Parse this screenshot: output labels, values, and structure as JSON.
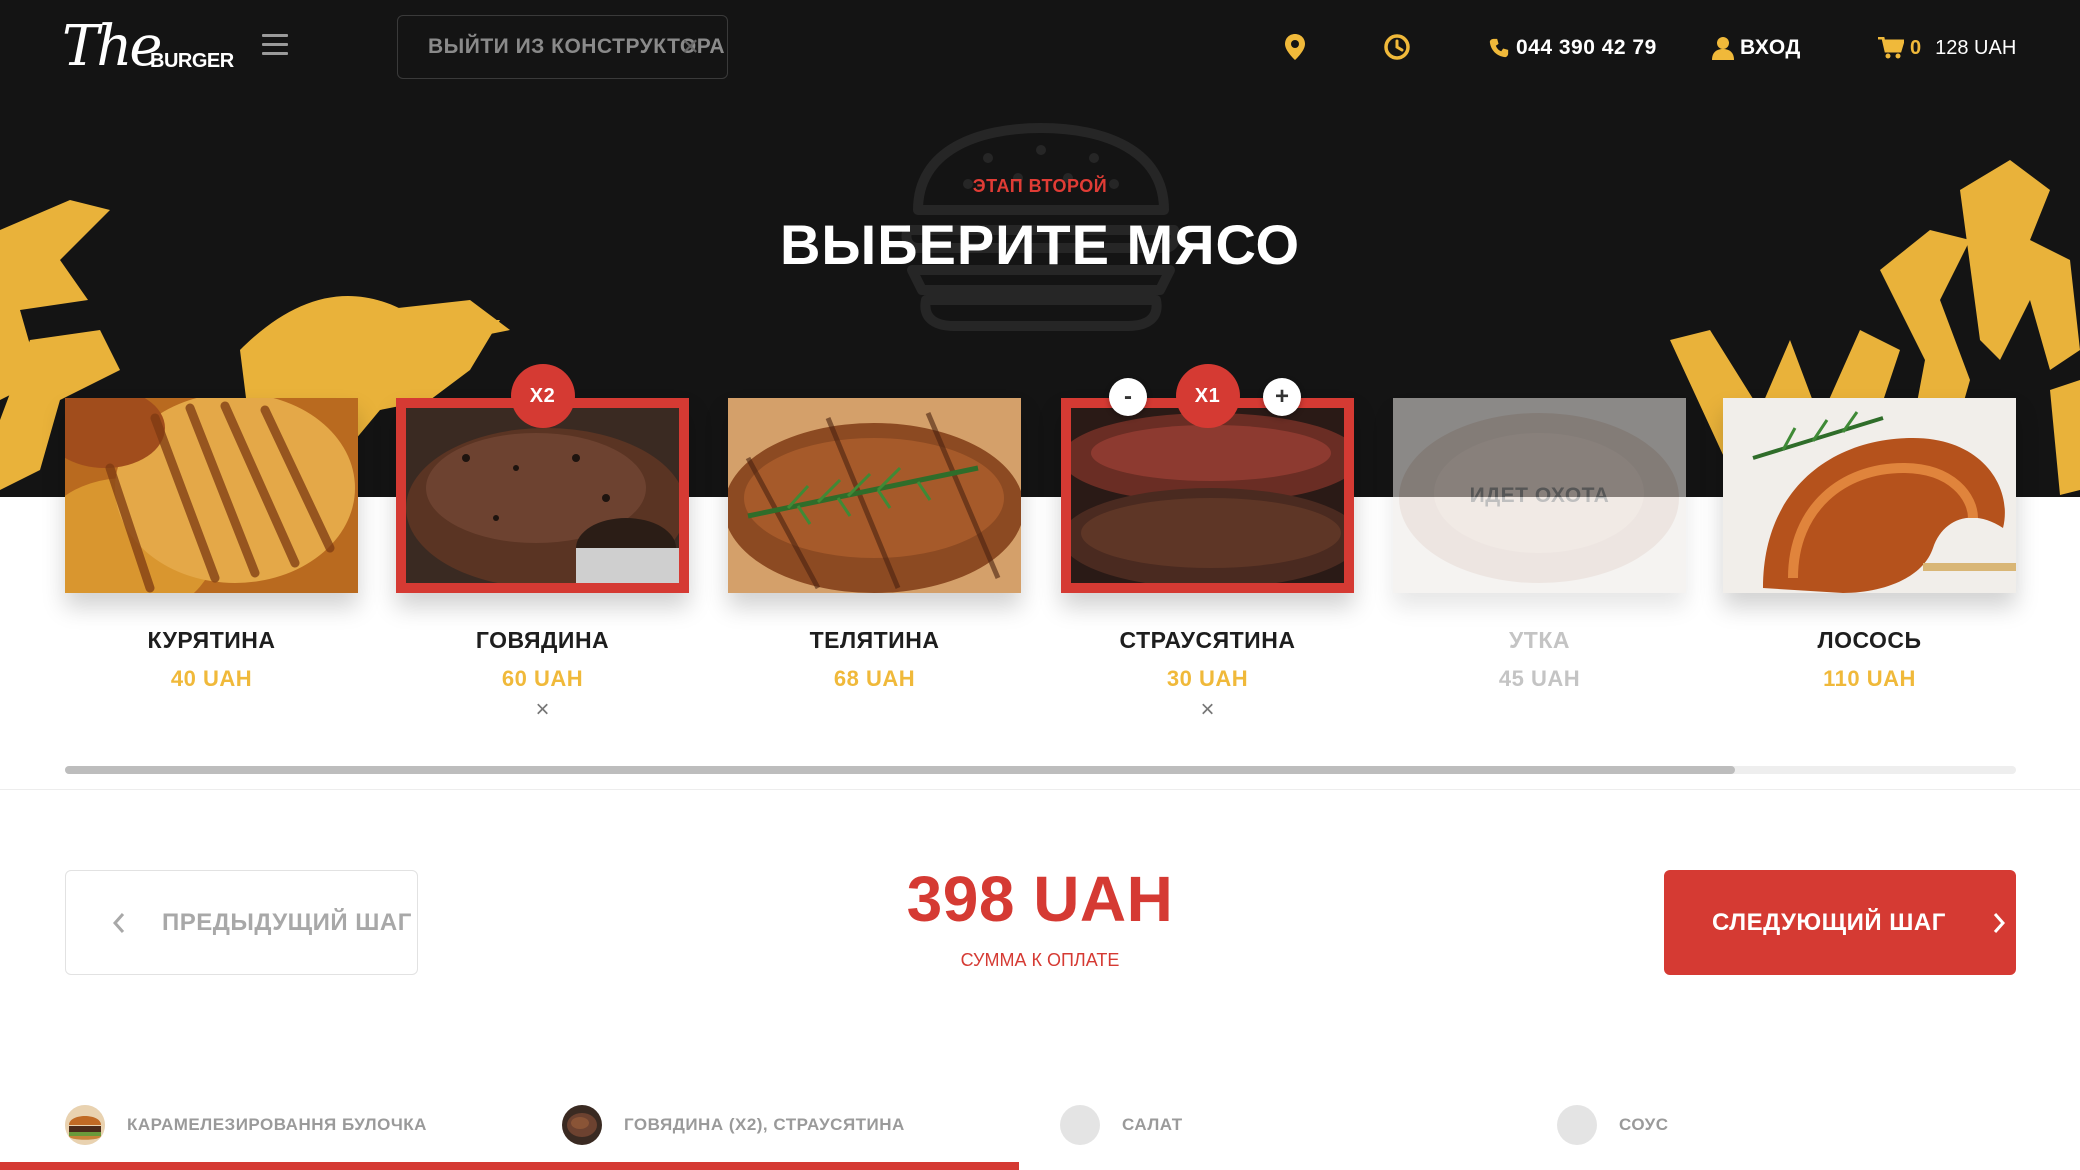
{
  "header": {
    "logo_script": "The",
    "logo_word": "BURGER",
    "exit_label": "ВЫЙТИ ИЗ КОНСТРУКТОРА",
    "phone": "044 390 42 79",
    "login_label": "ВХОД",
    "cart_count": "0",
    "cart_total": "128 UAH",
    "accent_color": "#f0b93a"
  },
  "hero": {
    "stage": "ЭТАП ВТОРОЙ",
    "title": "ВЫБЕРИТЕ МЯСО"
  },
  "cards": [
    {
      "name": "КУРЯТИНА",
      "price": "40 UAH",
      "image": "grilled-chicken"
    },
    {
      "name": "ГОВЯДИНА",
      "price": "60 UAH",
      "image": "beef-steak",
      "qty_badge": "X2",
      "remove": "×"
    },
    {
      "name": "ТЕЛЯТИНА",
      "price": "68 UAH",
      "image": "veal-with-rosemary"
    },
    {
      "name": "СТРАУСЯТИНА",
      "price": "30 UAH",
      "image": "ostrich-steak",
      "qty_badge": "X1",
      "minus": "-",
      "plus": "+",
      "remove": "×"
    },
    {
      "name": "УТКА",
      "price": "45 UAH",
      "image": "duck-unavailable",
      "overlay": "ИДЕТ ОХОТА"
    },
    {
      "name": "ЛОСОСЬ",
      "price": "110 UAH",
      "image": "grilled-salmon"
    }
  ],
  "scroll": {
    "position_fraction": 0.856
  },
  "summary": {
    "prev_label": "ПРЕДЫДУЩИЙ ШАГ",
    "total": "398 UAH",
    "total_label": "СУММА К ОПЛАТЕ",
    "next_label": "СЛЕДУЮЩИЙ ШАГ",
    "brand_red": "#d53a33"
  },
  "steps": [
    {
      "label": "КАРАМЕЛЕЗИРОВАННЯ БУЛОЧКА",
      "icon": "bun"
    },
    {
      "label": "ГОВЯДИНА (X2), СТРАУСЯТИНА",
      "icon": "meat"
    },
    {
      "label": "САЛАТ",
      "icon": "empty"
    },
    {
      "label": "СОУС",
      "icon": "empty"
    }
  ],
  "progress": {
    "completed_steps": 2,
    "total_steps": 4
  }
}
